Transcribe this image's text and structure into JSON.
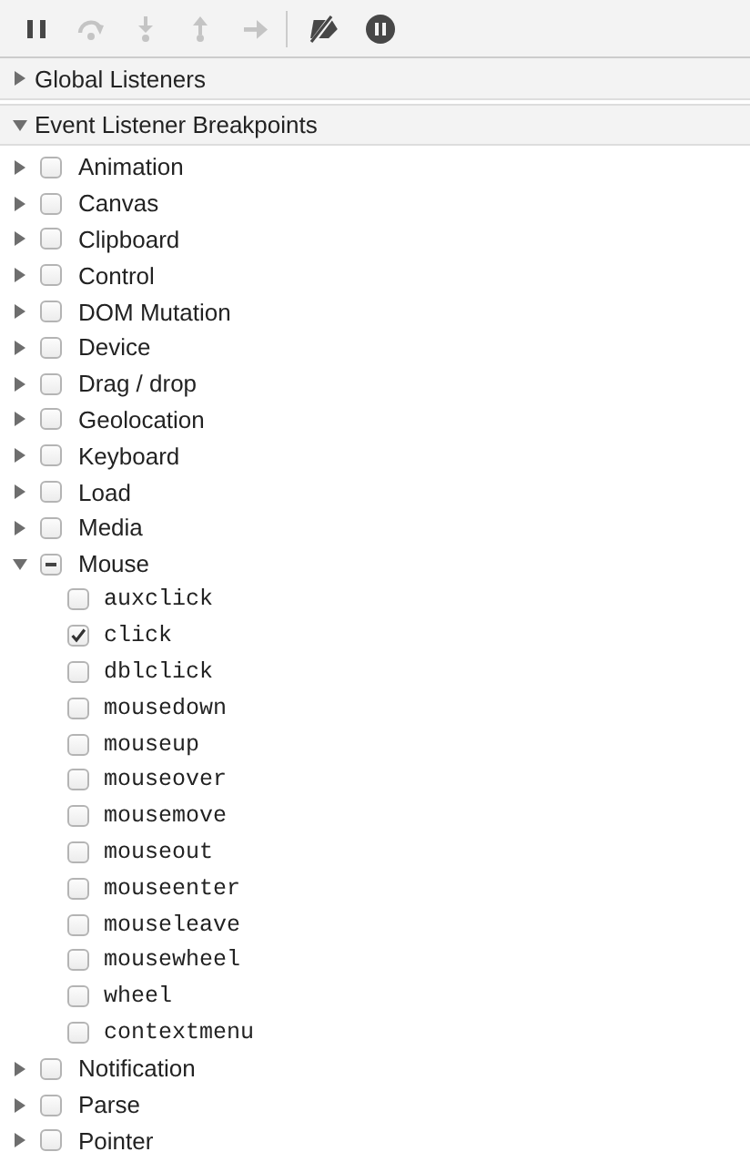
{
  "toolbar": [
    {
      "kind": "pause",
      "disabled": false
    },
    {
      "kind": "step-over",
      "disabled": true
    },
    {
      "kind": "step-into",
      "disabled": true
    },
    {
      "kind": "step-out",
      "disabled": true
    },
    {
      "kind": "step",
      "disabled": true
    },
    {
      "kind": "separator"
    },
    {
      "kind": "deactivate-breakpoints",
      "disabled": false
    },
    {
      "kind": "pause-on-exceptions",
      "disabled": false
    }
  ],
  "sections": [
    {
      "title": "Global Listeners",
      "expanded": false
    },
    {
      "title": "Event Listener Breakpoints",
      "expanded": true,
      "items": [
        {
          "label": "Animation",
          "expanded": false,
          "checked": false,
          "indeterminate": false
        },
        {
          "label": "Canvas",
          "expanded": false,
          "checked": false,
          "indeterminate": false
        },
        {
          "label": "Clipboard",
          "expanded": false,
          "checked": false,
          "indeterminate": false
        },
        {
          "label": "Control",
          "expanded": false,
          "checked": false,
          "indeterminate": false
        },
        {
          "label": "DOM Mutation",
          "expanded": false,
          "checked": false,
          "indeterminate": false
        },
        {
          "label": "Device",
          "expanded": false,
          "checked": false,
          "indeterminate": false
        },
        {
          "label": "Drag / drop",
          "expanded": false,
          "checked": false,
          "indeterminate": false
        },
        {
          "label": "Geolocation",
          "expanded": false,
          "checked": false,
          "indeterminate": false
        },
        {
          "label": "Keyboard",
          "expanded": false,
          "checked": false,
          "indeterminate": false
        },
        {
          "label": "Load",
          "expanded": false,
          "checked": false,
          "indeterminate": false
        },
        {
          "label": "Media",
          "expanded": false,
          "checked": false,
          "indeterminate": false
        },
        {
          "label": "Mouse",
          "expanded": true,
          "checked": false,
          "indeterminate": true,
          "children": [
            {
              "label": "auxclick",
              "checked": false
            },
            {
              "label": "click",
              "checked": true
            },
            {
              "label": "dblclick",
              "checked": false
            },
            {
              "label": "mousedown",
              "checked": false
            },
            {
              "label": "mouseup",
              "checked": false
            },
            {
              "label": "mouseover",
              "checked": false
            },
            {
              "label": "mousemove",
              "checked": false
            },
            {
              "label": "mouseout",
              "checked": false
            },
            {
              "label": "mouseenter",
              "checked": false
            },
            {
              "label": "mouseleave",
              "checked": false
            },
            {
              "label": "mousewheel",
              "checked": false
            },
            {
              "label": "wheel",
              "checked": false
            },
            {
              "label": "contextmenu",
              "checked": false
            }
          ]
        },
        {
          "label": "Notification",
          "expanded": false,
          "checked": false,
          "indeterminate": false
        },
        {
          "label": "Parse",
          "expanded": false,
          "checked": false,
          "indeterminate": false
        },
        {
          "label": "Pointer",
          "expanded": false,
          "checked": false,
          "indeterminate": false
        }
      ]
    }
  ]
}
